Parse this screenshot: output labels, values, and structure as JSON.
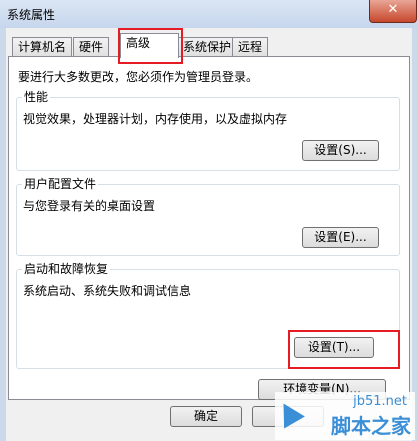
{
  "window": {
    "title": "系统属性",
    "close_symbol": "✕"
  },
  "tabs": [
    {
      "label": "计算机名",
      "active": false
    },
    {
      "label": "硬件",
      "active": false
    },
    {
      "label": "高级",
      "active": true
    },
    {
      "label": "系统保护",
      "active": false
    },
    {
      "label": "远程",
      "active": false
    }
  ],
  "panel": {
    "admin_note": "要进行大多数更改，您必须作为管理员登录。",
    "groups": [
      {
        "title": "性能",
        "desc": "视觉效果，处理器计划，内存使用，以及虚拟内存",
        "button": "设置(S)..."
      },
      {
        "title": "用户配置文件",
        "desc": "与您登录有关的桌面设置",
        "button": "设置(E)..."
      },
      {
        "title": "启动和故障恢复",
        "desc": "系统启动、系统失败和调试信息",
        "button": "设置(T)..."
      }
    ],
    "env_button": "环境变量(N)..."
  },
  "footer": {
    "ok_button": "确定"
  },
  "watermark": {
    "url": "jb51.net",
    "text": "脚本之家"
  },
  "colors": {
    "highlight": "#e51c23",
    "watermark": "#3b8fd6"
  }
}
